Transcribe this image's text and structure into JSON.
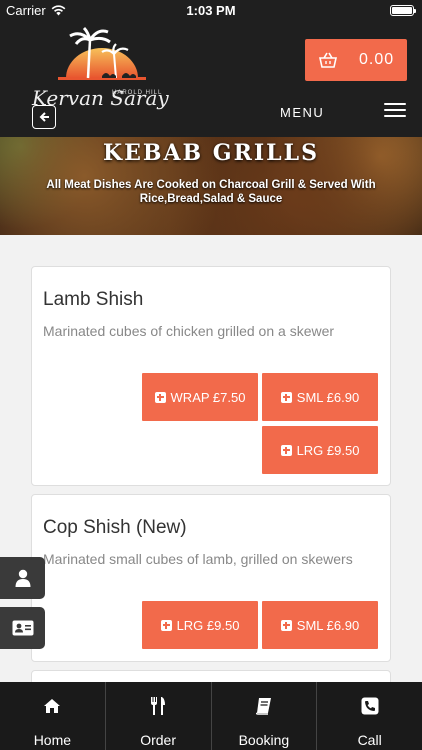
{
  "status_bar": {
    "carrier": "Carrier",
    "time": "1:03 PM"
  },
  "header": {
    "logo_small_text": "HAROLD HILL",
    "logo_name": "Kervan Saray",
    "cart_amount": "0.00",
    "menu_label": "MENU"
  },
  "banner": {
    "title": "KEBAB GRILLS",
    "subtitle": "All Meat Dishes Are Cooked on Charcoal Grill & Served With Rice,Bread,Salad & Sauce"
  },
  "items": [
    {
      "title": "Lamb Shish",
      "description": "Marinated cubes of chicken grilled on a skewer",
      "buttons": [
        "WRAP £7.50",
        "SML £6.90",
        "LRG £9.50"
      ]
    },
    {
      "title": "Cop Shish (New)",
      "description": "Marinated small cubes of lamb, grilled on skewers",
      "buttons": [
        "LRG £9.50",
        "SML £6.90"
      ]
    }
  ],
  "bottom_nav": [
    {
      "label": "Home",
      "icon": "home-icon"
    },
    {
      "label": "Order",
      "icon": "utensils-icon"
    },
    {
      "label": "Booking",
      "icon": "book-icon"
    },
    {
      "label": "Call",
      "icon": "phone-icon"
    }
  ],
  "colors": {
    "accent": "#f26a4b",
    "header_bg": "#1f1f1f",
    "nav_bg": "#1a1a1a"
  }
}
